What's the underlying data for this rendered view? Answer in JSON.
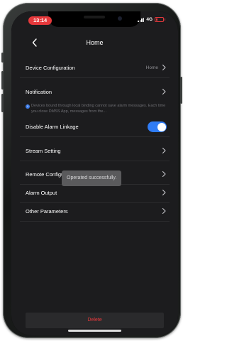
{
  "status_bar": {
    "time": "13:14",
    "network": "4G",
    "accent_color": "#e6393c"
  },
  "header": {
    "back_icon": "chevron-left-icon",
    "title": "Home"
  },
  "rows": {
    "device_configuration": {
      "label": "Device Configuration",
      "value": "Home"
    },
    "notification": {
      "label": "Notification"
    },
    "notice_text": "Devices bound through local binding cannot save alarm messages. Each time you close DMSS App, messages from the...",
    "disable_alarm_linkage": {
      "label": "Disable Alarm Linkage",
      "enabled": true,
      "toggle_color": "#2f7cf6"
    },
    "stream_setting": {
      "label": "Stream Setting"
    },
    "remote_configuration": {
      "label": "Remote Configuration"
    },
    "alarm_output": {
      "label": "Alarm Output"
    },
    "other_parameters": {
      "label": "Other Parameters"
    }
  },
  "toast": {
    "message": "Operated successfully."
  },
  "footer": {
    "delete_label": "Delete",
    "delete_color": "#e6393c"
  }
}
